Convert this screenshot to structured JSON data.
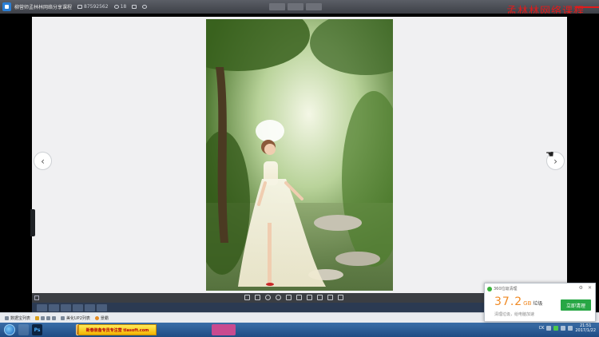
{
  "topbar": {
    "title": "柳营师孟林林网络分享课程",
    "viewer_count": "87592562",
    "like_count": "18",
    "watermark": "孟林林网络课程"
  },
  "photo": {
    "description_icon": "wedding-photo"
  },
  "infobar": {
    "items": [
      "数据宝列表",
      "美化UP2列表",
      "景霸"
    ]
  },
  "taskbar": {
    "ps_label": "Ps",
    "banner_text": "新春装备专员专注营 tlasoft.com",
    "clock_time": "21:51",
    "clock_date": "2017/1/22",
    "tray_label": "CK"
  },
  "popup": {
    "title": "360垃圾清理",
    "size_number": "37.2",
    "size_unit": "GB",
    "size_kind": "垃圾",
    "subtitle": "清理垃圾，给电脑加速",
    "button_label": "立即清理",
    "settings_symbol": "⚙",
    "close_symbol": "✕"
  },
  "colors": {
    "accent_red": "#e11b1b",
    "clean_green": "#28a745",
    "size_orange": "#f08a24"
  }
}
